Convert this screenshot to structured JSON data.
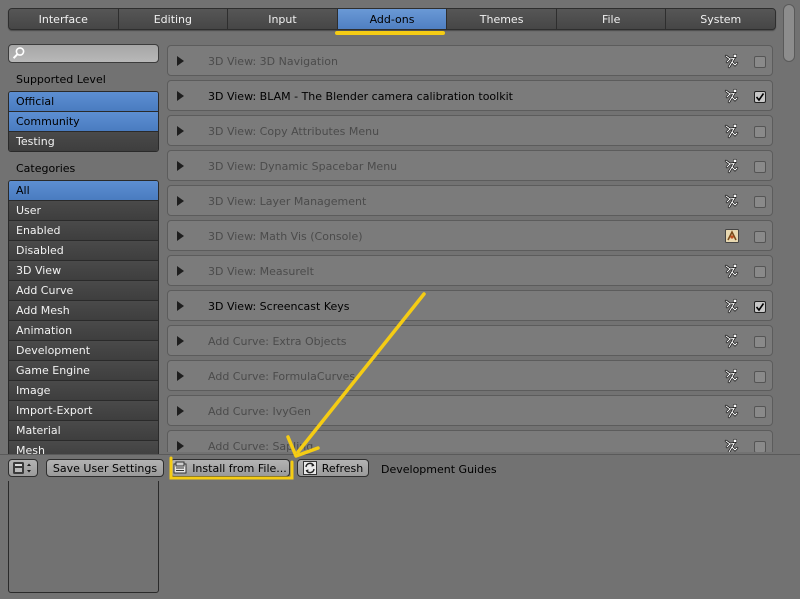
{
  "tabs": [
    "Interface",
    "Editing",
    "Input",
    "Add-ons",
    "Themes",
    "File",
    "System"
  ],
  "active_tab_index": 3,
  "sidebar": {
    "search_placeholder": "",
    "supported_level_label": "Supported Level",
    "levels": [
      {
        "label": "Official",
        "selected": true
      },
      {
        "label": "Community",
        "selected": true
      },
      {
        "label": "Testing",
        "selected": false
      }
    ],
    "categories_label": "Categories",
    "categories": [
      {
        "label": "All",
        "selected": true
      },
      {
        "label": "User",
        "selected": false
      },
      {
        "label": "Enabled",
        "selected": false
      },
      {
        "label": "Disabled",
        "selected": false
      },
      {
        "label": "3D View",
        "selected": false
      },
      {
        "label": "Add Curve",
        "selected": false
      },
      {
        "label": "Add Mesh",
        "selected": false
      },
      {
        "label": "Animation",
        "selected": false
      },
      {
        "label": "Development",
        "selected": false
      },
      {
        "label": "Game Engine",
        "selected": false
      },
      {
        "label": "Image",
        "selected": false
      },
      {
        "label": "Import-Export",
        "selected": false
      },
      {
        "label": "Material",
        "selected": false
      },
      {
        "label": "Mesh",
        "selected": false
      }
    ]
  },
  "addons": [
    {
      "label": "3D View: 3D Navigation",
      "enabled": false,
      "icon": "community-icon"
    },
    {
      "label": "3D View: BLAM - The Blender camera calibration toolkit",
      "enabled": true,
      "icon": "community-icon"
    },
    {
      "label": "3D View: Copy Attributes Menu",
      "enabled": false,
      "icon": "community-icon"
    },
    {
      "label": "3D View: Dynamic Spacebar Menu",
      "enabled": false,
      "icon": "community-icon"
    },
    {
      "label": "3D View: Layer Management",
      "enabled": false,
      "icon": "community-icon"
    },
    {
      "label": "3D View: Math Vis (Console)",
      "enabled": false,
      "icon": "official-icon"
    },
    {
      "label": "3D View: MeasureIt",
      "enabled": false,
      "icon": "community-icon"
    },
    {
      "label": "3D View: Screencast Keys",
      "enabled": true,
      "icon": "community-icon"
    },
    {
      "label": "Add Curve: Extra Objects",
      "enabled": false,
      "icon": "community-icon"
    },
    {
      "label": "Add Curve: FormulaCurves",
      "enabled": false,
      "icon": "community-icon"
    },
    {
      "label": "Add Curve: IvyGen",
      "enabled": false,
      "icon": "community-icon"
    },
    {
      "label": "Add Curve: Sapling",
      "enabled": false,
      "icon": "community-icon"
    }
  ],
  "footer": {
    "save_label": "Save User Settings",
    "install_label": "Install from File...",
    "refresh_label": "Refresh",
    "guides_label": "Development Guides"
  },
  "colors": {
    "active_tab": "#5a8ace",
    "annotation_yellow": "#f5cc14",
    "background": "#727272"
  }
}
